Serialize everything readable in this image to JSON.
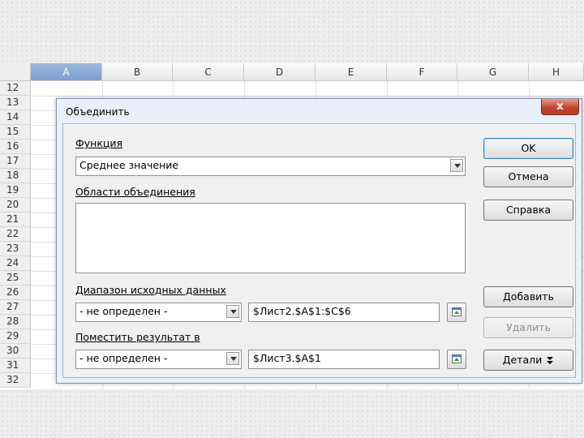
{
  "spreadsheet": {
    "columns": [
      "A",
      "B",
      "C",
      "D",
      "E",
      "F",
      "G",
      "H"
    ],
    "selected_column": "A",
    "rows": [
      "12",
      "13",
      "14",
      "15",
      "16",
      "17",
      "18",
      "19",
      "20",
      "21",
      "22",
      "23",
      "24",
      "25",
      "26",
      "27",
      "28",
      "29",
      "30",
      "31",
      "32"
    ]
  },
  "dialog": {
    "title": "Объединить",
    "close_label": "x",
    "function_label": "Функция",
    "function_value": "Среднее значение",
    "areas_label": "Области объединения",
    "source_range_label": "Диапазон исходных данных",
    "source_range_combo": "- не определен -",
    "source_range_value": "$Лист2.$A$1:$C$6",
    "copy_results_label": "Поместить результат в",
    "copy_results_combo": "- не определен -",
    "copy_results_value": "$Лист3.$A$1",
    "buttons": {
      "ok": "OK",
      "cancel": "Отмена",
      "help": "Справка",
      "add": "Добавить",
      "delete": "Удалить",
      "more": "Детали"
    }
  }
}
